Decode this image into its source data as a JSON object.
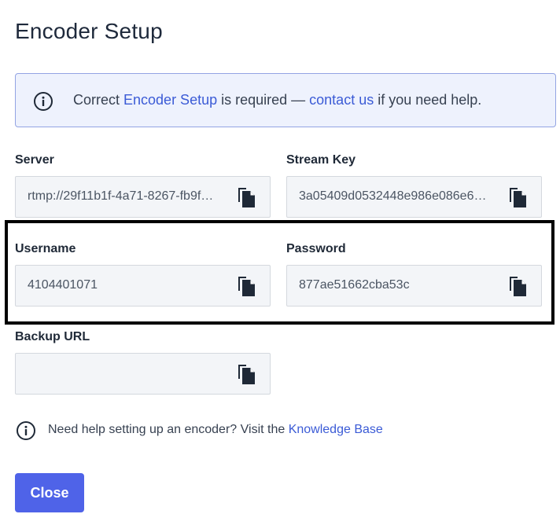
{
  "dialog": {
    "title": "Encoder Setup"
  },
  "banner": {
    "icon": "info-icon",
    "text_before": "Correct ",
    "link1": "Encoder Setup",
    "text_middle": " is required — ",
    "link2": "contact us",
    "text_after": " if you need help."
  },
  "fields": {
    "server": {
      "label": "Server",
      "value": "rtmp://29f11b1f-4a71-8267-fb9f…"
    },
    "stream_key": {
      "label": "Stream Key",
      "value": "3a05409d0532448e986e086e6…"
    },
    "username": {
      "label": "Username",
      "value": "4104401071"
    },
    "password": {
      "label": "Password",
      "value": "877ae51662cba53c"
    },
    "backup_url": {
      "label": "Backup URL",
      "value": ""
    }
  },
  "copy_icon": "copy-icon",
  "help": {
    "icon": "info-icon",
    "text": "Need help setting up an encoder? Visit the ",
    "link": "Knowledge Base"
  },
  "close_button": {
    "label": "Close"
  },
  "colors": {
    "accent": "#4f63e8",
    "link": "#3b5bd6",
    "banner_bg": "#eef2fd",
    "banner_border": "#93a4e3",
    "field_bg": "#f3f5f8",
    "highlight_border": "#000000"
  }
}
